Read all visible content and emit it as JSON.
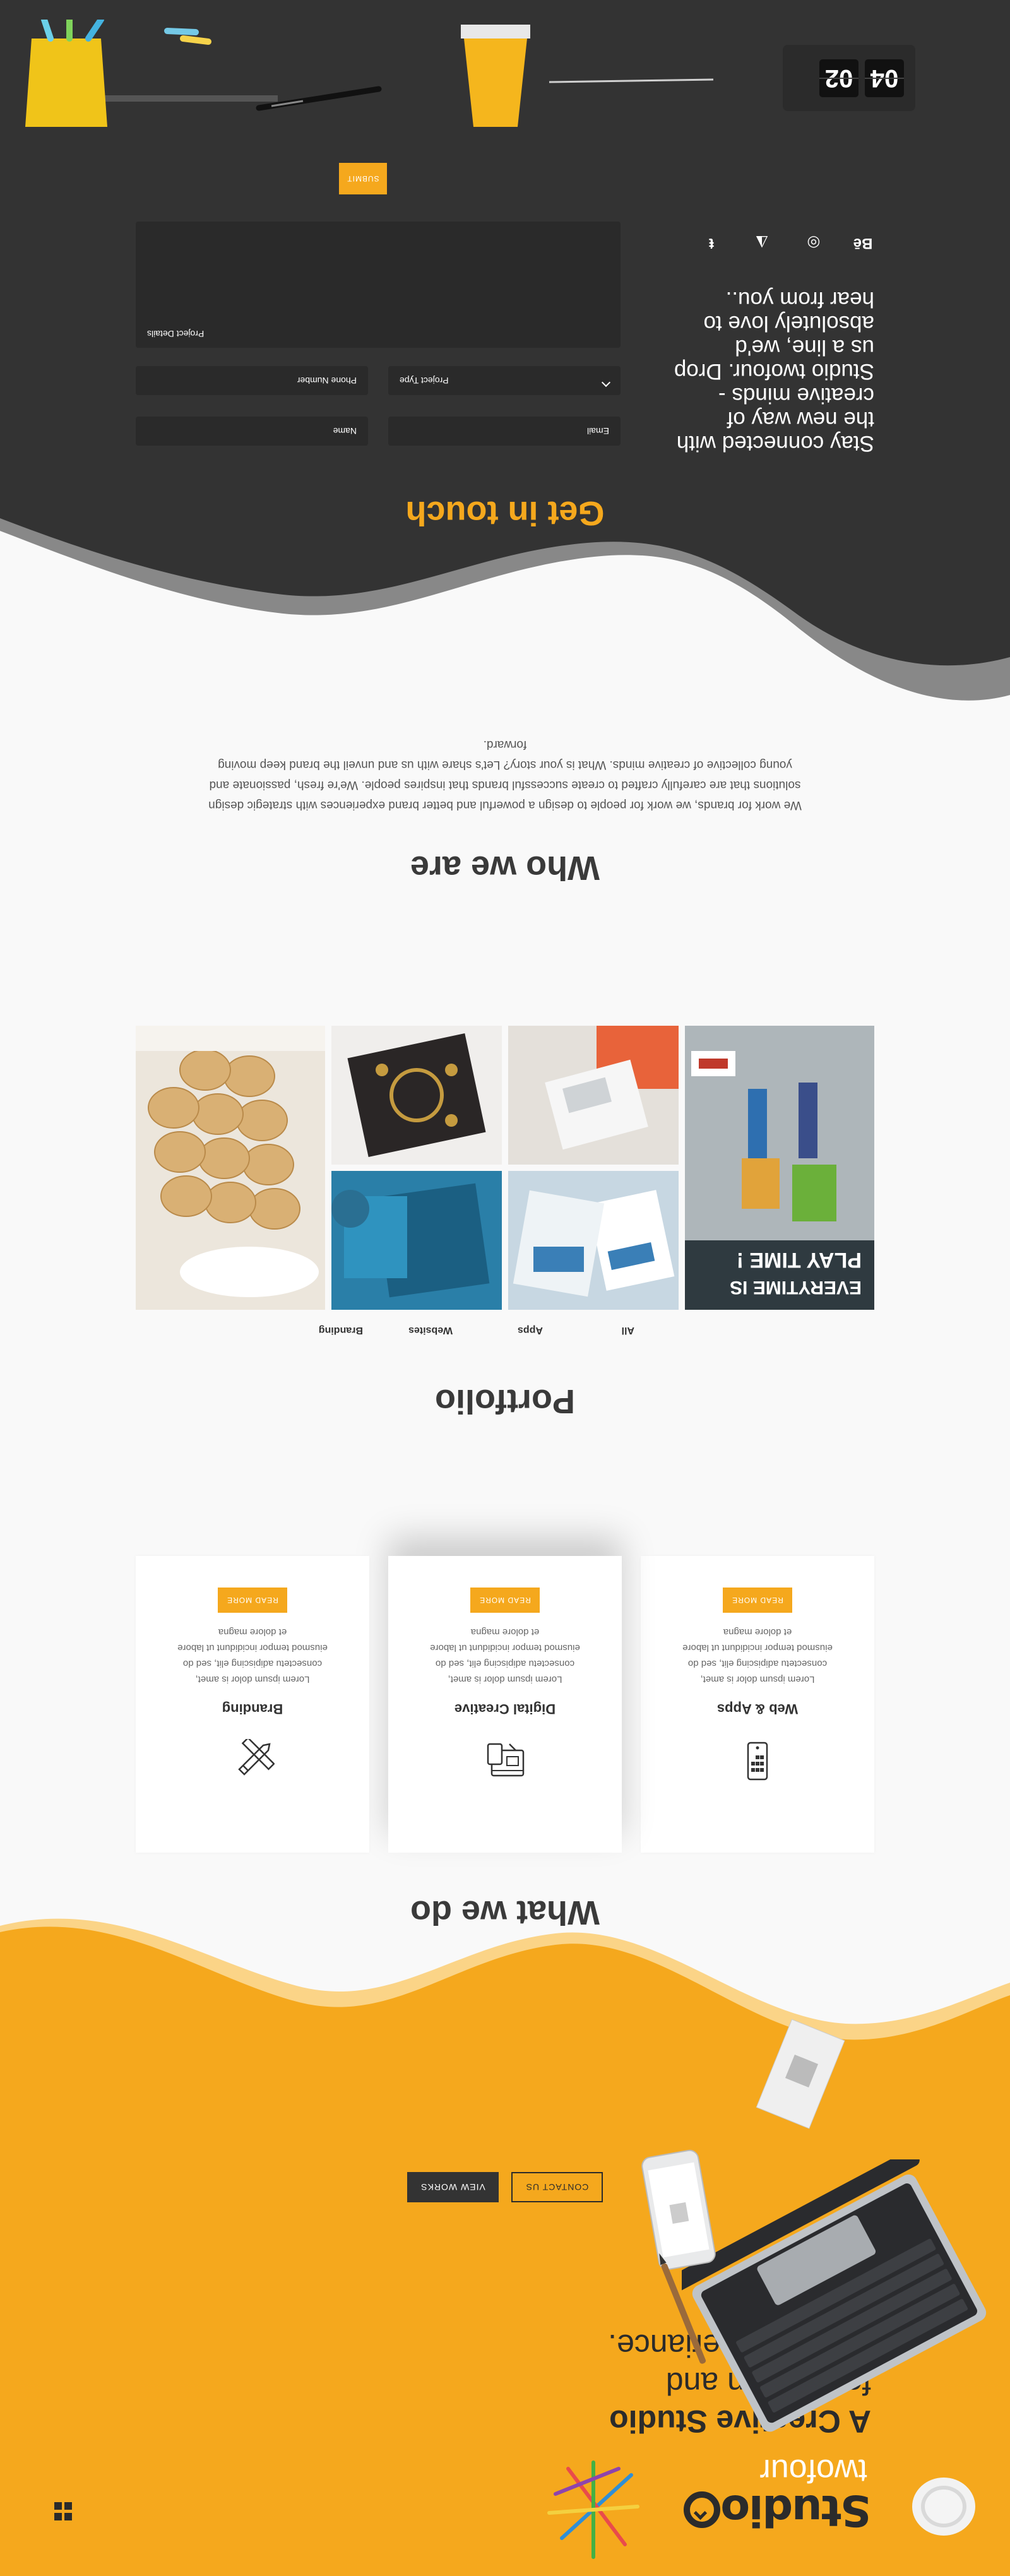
{
  "brand": {
    "name": "Studio",
    "sub": "twofour",
    "accent_color": "#f5a81d",
    "dark_color": "#333333"
  },
  "hero": {
    "title_line1": "A Creative Studio",
    "title_line2": "for Design and",
    "title_line3": "Digital Experiance.",
    "btn_contact": "CONTACT US",
    "btn_works": "VIEW WORKS",
    "menu_icon": "grid-menu-icon"
  },
  "what_we_do": {
    "title": "What we do",
    "cards": [
      {
        "icon": "pencil-ruler-icon",
        "title": "Branding",
        "text": "Lorem ipsum dolor is amet, consectetu adipiscing elit, sed do eiusmod tempor incididunt ut labore et dolore magna",
        "button": "READ MORE"
      },
      {
        "icon": "digital-creative-icon",
        "title": "Digital Creative",
        "text": "Lorem ipsum dolor is amet, consectetu adipiscing elit, sed do eiusmod tempor incididunt ut labore et dolore magna",
        "button": "READ MORE"
      },
      {
        "icon": "mobile-apps-icon",
        "title": "Web & Apps",
        "text": "Lorem ipsum dolor is amet, consectetu adipiscing elit, sed do eiusmod tempor incididunt ut labore et dolore magna",
        "button": "READ MORE"
      }
    ]
  },
  "portfolio": {
    "title": "Portfolio",
    "filters": [
      "All",
      "Apps",
      "Websites",
      "Branding"
    ],
    "poster_text": "EVERYTIME IS PLAY TIME !"
  },
  "who_we_are": {
    "title": "Who we are",
    "text": "We work for brands, we work for people to design a powerful and better brand experiences with strategic design solutions that are carefully crafted to create successful brands that inspires people. We're fresh, passionate and young collective of creative minds. What is your story? Let's share with us and unveil the brand keep moving forward."
  },
  "contact": {
    "title": "Get in touch",
    "tagline": "Stay connected with the new way of creative minds - Studio twofour. Drop us a line, we'd absolutely love to hear from you..",
    "fields": {
      "name": "Name",
      "email": "Email",
      "phone": "Phone Number",
      "project_type": "Project Type",
      "project_details": "Project Details"
    },
    "submit": "SUBMIT",
    "socials": [
      "behance-icon",
      "instagram-icon",
      "snapchat-icon",
      "tumblr-icon"
    ],
    "social_glyphs": [
      "Bē",
      "◎",
      "◮",
      "ŧ"
    ],
    "clock": {
      "left": "04",
      "right": "02"
    }
  }
}
